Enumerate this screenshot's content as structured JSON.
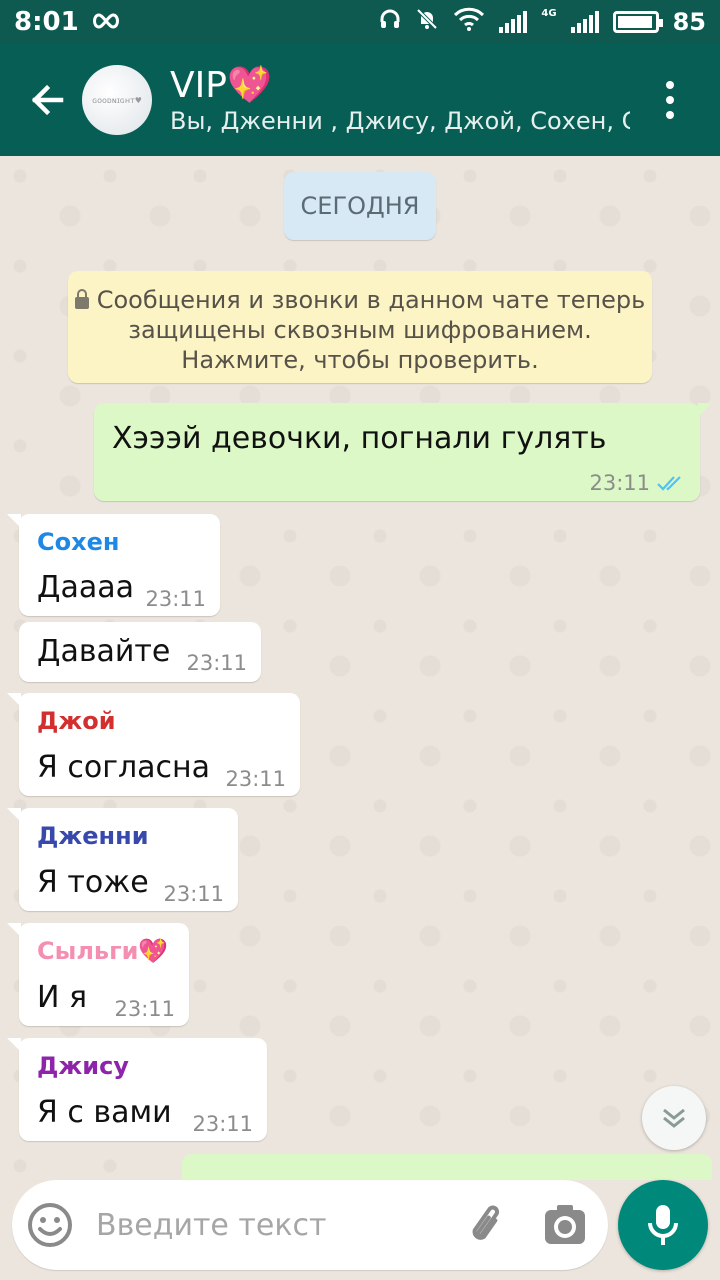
{
  "status_bar": {
    "time": "8:01",
    "battery": "85",
    "network": "4G"
  },
  "header": {
    "title": "VIP💖",
    "subtitle": "Вы, Дженни , Джису, Джой, Сохен, С...",
    "avatar_text": "ɢᴏᴏᴅɴɪɢʜᴛ♥"
  },
  "chat": {
    "date_label": "СЕГОДНЯ",
    "encryption_notice": {
      "line1": "Сообщения и звонки в данном чате теперь",
      "line2": "защищены сквозным шифрованием.",
      "line3": "Нажмите, чтобы проверить."
    },
    "messages": [
      {
        "direction": "out",
        "sender": "",
        "text": "Хэээй девочки, погнали гулять",
        "time": "23:11",
        "status": "read"
      },
      {
        "direction": "in",
        "sender": "Сохен",
        "sender_color": "#1e88e5",
        "text": "Даааа",
        "time": "23:11"
      },
      {
        "direction": "in",
        "sender": "",
        "text": "Давайте",
        "time": "23:11"
      },
      {
        "direction": "in",
        "sender": "Джой",
        "sender_color": "#d32f2f",
        "text": "Я согласна",
        "time": "23:11"
      },
      {
        "direction": "in",
        "sender": "Дженни",
        "sender_color": "#3949ab",
        "text": "Я тоже",
        "time": "23:11"
      },
      {
        "direction": "in",
        "sender": "Сыльги💖",
        "sender_color": "#f48fb1",
        "text": "И я",
        "time": "23:11"
      },
      {
        "direction": "in",
        "sender": "Джису",
        "sender_color": "#8e24aa",
        "text": "Я с вами",
        "time": "23:11"
      }
    ]
  },
  "input": {
    "placeholder": "Введите текст"
  },
  "colors": {
    "header_bg": "#075e54",
    "status_bg": "#0e5a50",
    "outgoing_bubble": "#dcf8c6",
    "incoming_bubble": "#ffffff",
    "accent": "#00897b",
    "read_ticks": "#4fc3f7"
  },
  "icons": {
    "back": "arrow-left-icon",
    "menu": "more-vert-icon",
    "emoji": "smiley-icon",
    "attach": "paperclip-icon",
    "camera": "camera-icon",
    "mic": "microphone-icon",
    "scroll": "double-chevron-down-icon"
  }
}
